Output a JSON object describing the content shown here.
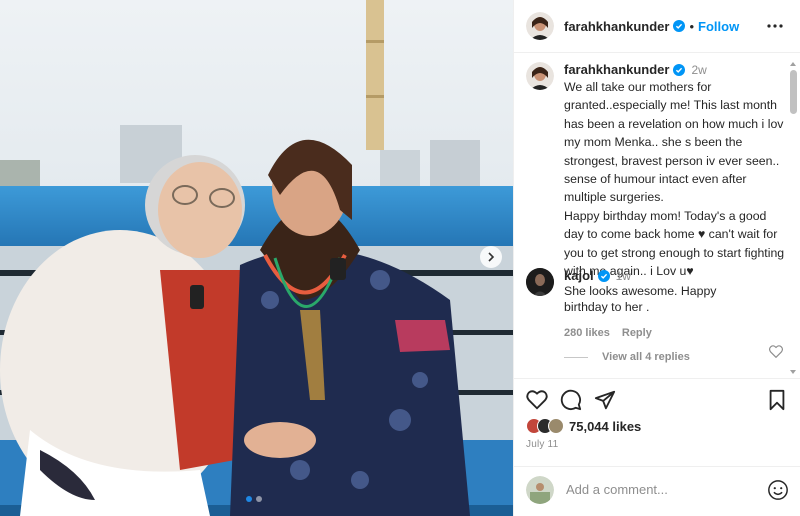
{
  "post": {
    "author": "farahkhankunder",
    "separator": "•",
    "follow_label": "Follow",
    "caption_time": "2w",
    "caption": "We all take our mothers for granted..especially me! This last month has been a revelation on how much i lov my mom Menka.. she s been the strongest, bravest person iv ever seen.. sense of humour intact even after multiple surgeries.\nHappy birthday mom! Today's a good day to come back home ♥ can't wait for you to get strong enough to start fighting with me again.. i Lov u♥",
    "likes": "75,044 likes",
    "date": "July 11"
  },
  "reply": {
    "author": "kajol",
    "time": "1w",
    "text": "She looks awesome. Happy birthday to her .",
    "likes": "280 likes",
    "reply_label": "Reply",
    "view_replies": "View all 4 replies"
  },
  "composer": {
    "placeholder": "Add a comment..."
  },
  "icons": {
    "more": "more-horizontal-icon",
    "like": "heart-icon",
    "comment": "comment-icon",
    "share": "paper-plane-icon",
    "save": "bookmark-icon",
    "emoji": "smiley-icon",
    "verified": "verified-badge-icon",
    "next": "chevron-right-icon"
  },
  "colors": {
    "accent": "#0095f6",
    "muted": "#8e8e8e",
    "text": "#262626",
    "verified": "#0095f6",
    "carousel_active": "#1e88e5"
  },
  "carousel": {
    "slides": 2,
    "active_index": 0
  }
}
